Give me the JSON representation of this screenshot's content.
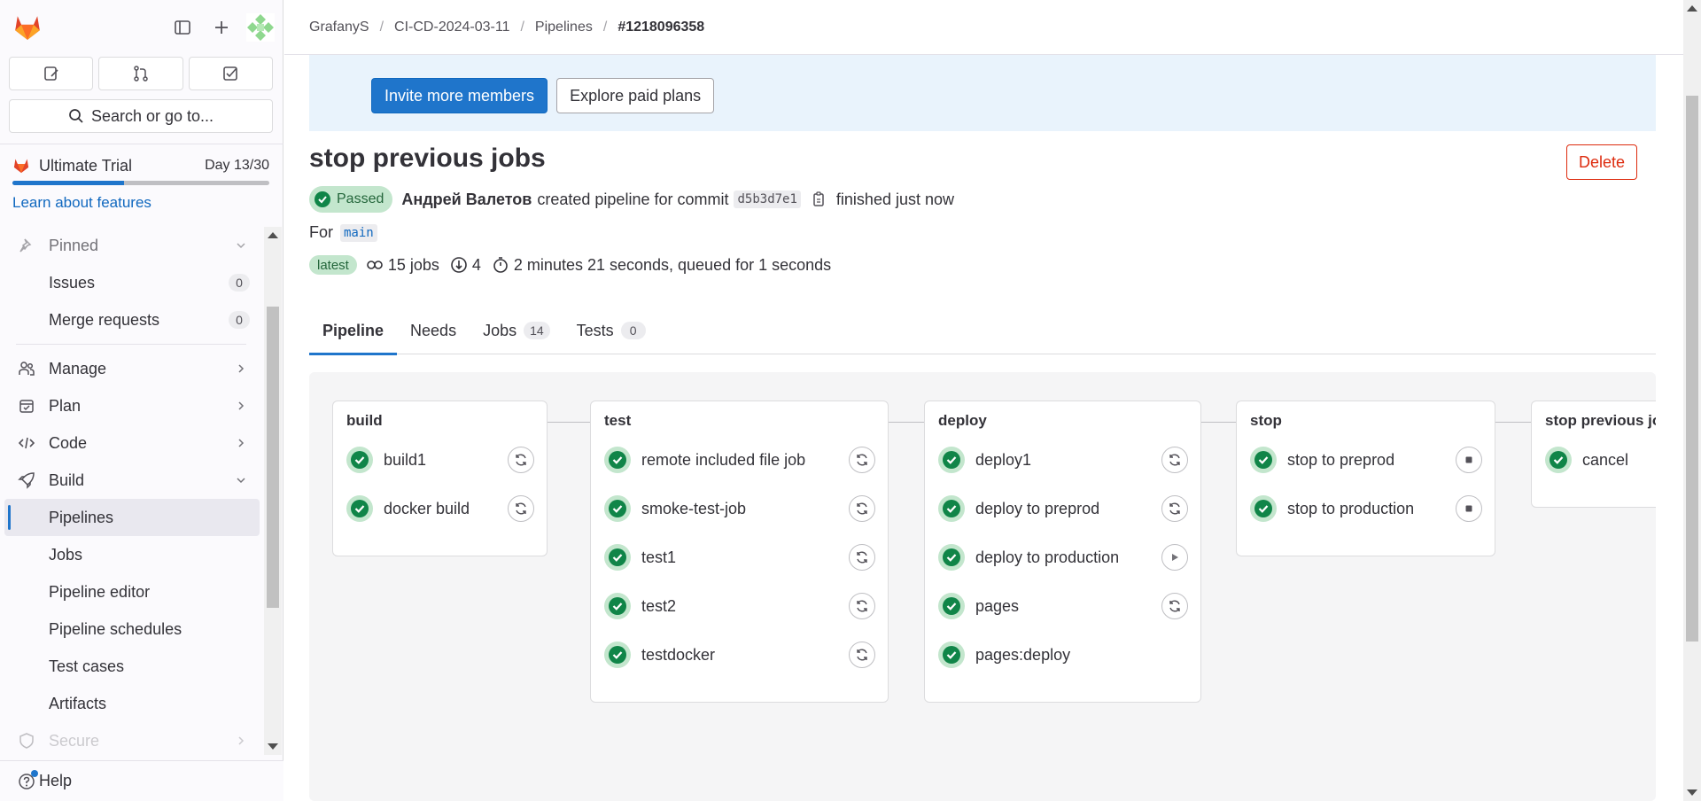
{
  "sidebar": {
    "search_label": "Search or go to...",
    "trial": {
      "title": "Ultimate Trial",
      "day": "Day 13/30",
      "progress": 0.433,
      "link": "Learn about features"
    },
    "pinned_label": "Pinned",
    "pinned": [
      {
        "label": "Issues",
        "count": "0"
      },
      {
        "label": "Merge requests",
        "count": "0"
      }
    ],
    "sections": {
      "manage": "Manage",
      "plan": "Plan",
      "code": "Code",
      "build": "Build",
      "secure": "Secure"
    },
    "build_items": [
      "Pipelines",
      "Jobs",
      "Pipeline editor",
      "Pipeline schedules",
      "Test cases",
      "Artifacts"
    ],
    "help": "Help"
  },
  "breadcrumb": [
    "GrafanyS",
    "CI-CD-2024-03-11",
    "Pipelines",
    "#1218096358"
  ],
  "banner": {
    "primary": "Invite more members",
    "secondary": "Explore paid plans"
  },
  "pipeline": {
    "title": "stop previous jobs",
    "delete_label": "Delete",
    "status": "Passed",
    "author": "Андрей Валетов",
    "created_text": "created pipeline for commit",
    "commit": "d5b3d7e1",
    "finished_text": "finished just now",
    "for_label": "For",
    "ref": "main",
    "latest_label": "latest",
    "jobs_text": "15 jobs",
    "needs_count": "4",
    "duration_text": "2 minutes 21 seconds, queued for 1 seconds"
  },
  "tabs": [
    {
      "label": "Pipeline",
      "count": null
    },
    {
      "label": "Needs",
      "count": null
    },
    {
      "label": "Jobs",
      "count": "14"
    },
    {
      "label": "Tests",
      "count": "0"
    }
  ],
  "stages": [
    {
      "name": "build",
      "jobs": [
        {
          "name": "build1",
          "action": "retry"
        },
        {
          "name": "docker build",
          "action": "retry"
        }
      ]
    },
    {
      "name": "test",
      "jobs": [
        {
          "name": "remote included file job",
          "action": "retry"
        },
        {
          "name": "smoke-test-job",
          "action": "retry"
        },
        {
          "name": "test1",
          "action": "retry"
        },
        {
          "name": "test2",
          "action": "retry"
        },
        {
          "name": "testdocker",
          "action": "retry"
        }
      ]
    },
    {
      "name": "deploy",
      "jobs": [
        {
          "name": "deploy1",
          "action": "retry"
        },
        {
          "name": "deploy to preprod",
          "action": "retry"
        },
        {
          "name": "deploy to production",
          "action": "play"
        },
        {
          "name": "pages",
          "action": "retry"
        },
        {
          "name": "pages:deploy",
          "action": null
        }
      ]
    },
    {
      "name": "stop",
      "jobs": [
        {
          "name": "stop to preprod",
          "action": "stop"
        },
        {
          "name": "stop to production",
          "action": "stop"
        }
      ]
    },
    {
      "name": "stop previous jobs",
      "jobs": [
        {
          "name": "cancel",
          "action": null
        }
      ]
    }
  ],
  "colors": {
    "accent": "#1f75cb",
    "success": "#108548",
    "success_bg": "#c3e6cd",
    "danger": "#dd2b0e"
  },
  "icons": {
    "logo": "gitlab-tanuki-icon",
    "top": [
      "sidebar-toggle-icon",
      "plus-icon",
      "avatar"
    ],
    "quick": [
      "issues-icon",
      "merge-request-icon",
      "todo-icon"
    ],
    "retry": "retry-icon",
    "play": "play-icon",
    "stop": "stop-icon"
  }
}
